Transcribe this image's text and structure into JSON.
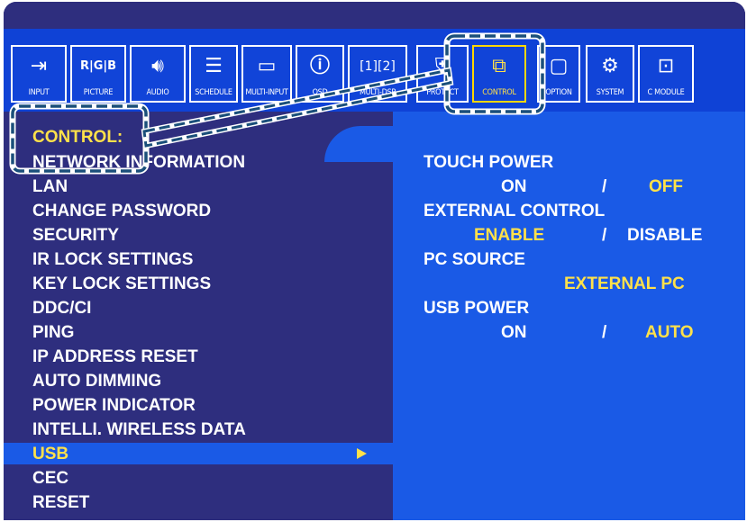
{
  "toolbar": {
    "tabs": [
      {
        "label": "INPUT",
        "icon": "input-icon"
      },
      {
        "label": "PICTURE",
        "icon": "rgb-icon"
      },
      {
        "label": "AUDIO",
        "icon": "speaker-icon"
      },
      {
        "label": "SCHEDULE",
        "icon": "schedule-icon"
      },
      {
        "label": "MULTI-INPUT",
        "icon": "multi-input-icon"
      },
      {
        "label": "OSD",
        "icon": "info-icon"
      },
      {
        "label": "MULTI-DSP",
        "icon": "multi-display-icon"
      },
      {
        "label": "PROTECT",
        "icon": "protect-icon"
      },
      {
        "label": "CONTROL",
        "icon": "control-icon"
      },
      {
        "label": "OPTION",
        "icon": "option-icon"
      },
      {
        "label": "SYSTEM",
        "icon": "system-icon"
      },
      {
        "label": "C MODULE",
        "icon": "compute-module-icon"
      }
    ],
    "active_tab": "CONTROL"
  },
  "menu": {
    "title": "CONTROL:",
    "items": [
      "NETWORK INFORMATION",
      "LAN",
      "CHANGE PASSWORD",
      "SECURITY",
      "IR LOCK SETTINGS",
      "KEY LOCK SETTINGS",
      "DDC/CI",
      "PING",
      "IP ADDRESS RESET",
      "AUTO DIMMING",
      "POWER INDICATOR",
      "INTELLI. WIRELESS DATA",
      "USB",
      "CEC",
      "RESET"
    ],
    "selected": "USB"
  },
  "settings": {
    "touch_power": {
      "label": "TOUCH POWER",
      "opt1": "ON",
      "sep": "/",
      "opt2": "OFF",
      "selected": "OFF"
    },
    "external_control": {
      "label": "EXTERNAL CONTROL",
      "opt1": "ENABLE",
      "sep": "/",
      "opt2": "DISABLE",
      "selected": "ENABLE"
    },
    "pc_source": {
      "label": "PC SOURCE",
      "value": "EXTERNAL PC"
    },
    "usb_power": {
      "label": "USB POWER",
      "opt1": "ON",
      "sep": "/",
      "opt2": "AUTO",
      "selected": "AUTO"
    }
  },
  "colors": {
    "menu_bg": "#2e2e7e",
    "panel_bg": "#1a5ae6",
    "iconbar_bg": "#0f42d6",
    "highlight": "#ffe14a",
    "callout": "#1a4f7a"
  }
}
